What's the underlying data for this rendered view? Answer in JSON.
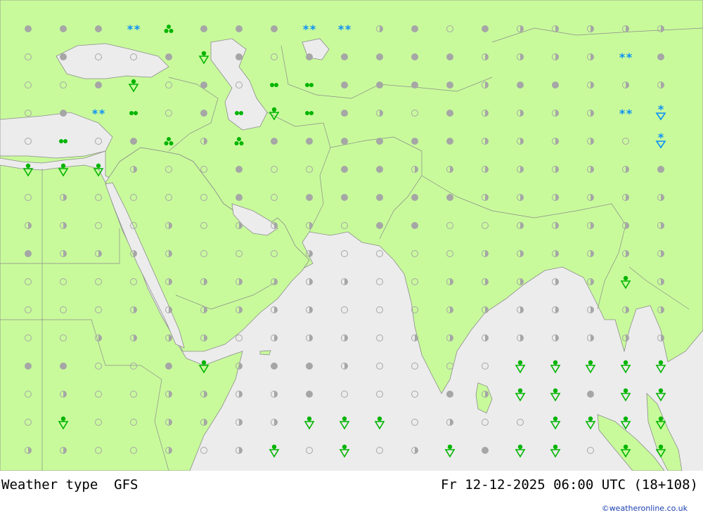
{
  "title": {
    "left": "Weather type  GFS",
    "right": "Fr 12-12-2025 06:00 UTC (18+108)"
  },
  "credit": "©weatheronline.co.uk",
  "colors": {
    "land": "#c8fa9b",
    "sea": "#ececec",
    "border": "#8c8c8c",
    "cloud": "#a6a6a6",
    "rain": "#00b400",
    "snow": "#0b8ff7"
  },
  "grid": {
    "cols": 19,
    "rows": 16,
    "legend": "o = clear, h = partly cloudy, c = cloudy, r = rain shower, s = snow, d = drizzle, t = showers, x = snow shower",
    "cells": [
      "cccstcccsshcochhhhh",
      "ocoocrcoccccchhhhsc",
      "oocrocoddcccchcchhh",
      "ocsdocdrdchochhhhsx",
      "odocthtcccccchhhhox",
      "rrrhoocoocchhhhhhhc",
      "ohoooococcccchhhhhh",
      "hhoohohhhoccoohhhhh",
      "chhhhooohoooohhhhhh",
      "oooohhhhhhoohhhhhrh",
      "ooohhhhhhooohhhhhhh",
      "oohhhhohhhohhhhhhhh",
      "ccoocrhcchoooorrrrr",
      "ohoohhhhcooochrrcrr",
      "oroohhhhrrrohoorrrr",
      "hhoohohrorohrcrrorr"
    ]
  }
}
